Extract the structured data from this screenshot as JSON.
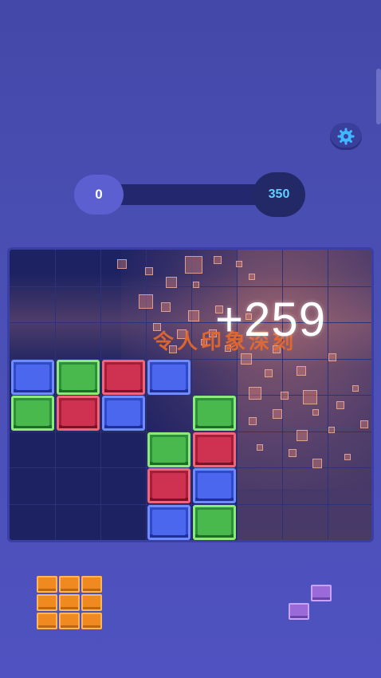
{
  "hud": {
    "current_score": "0",
    "target_score": "350",
    "progress": 0
  },
  "combo": {
    "points": "+259",
    "label": "令人印象深刻"
  },
  "colors": {
    "blue": "#4a67ee",
    "green": "#49b94d",
    "red": "#cf3250",
    "orange_piece": "#f08a20",
    "purple_piece": "#9a6ad8"
  },
  "board": {
    "columns": 8,
    "rows": 8,
    "blocks": [
      {
        "row": 3,
        "col": 0,
        "color": "blue"
      },
      {
        "row": 3,
        "col": 1,
        "color": "green"
      },
      {
        "row": 3,
        "col": 2,
        "color": "red"
      },
      {
        "row": 3,
        "col": 3,
        "color": "blue"
      },
      {
        "row": 4,
        "col": 0,
        "color": "green"
      },
      {
        "row": 4,
        "col": 1,
        "color": "red"
      },
      {
        "row": 4,
        "col": 2,
        "color": "blue"
      },
      {
        "row": 4,
        "col": 4,
        "color": "green"
      },
      {
        "row": 5,
        "col": 3,
        "color": "green"
      },
      {
        "row": 5,
        "col": 4,
        "color": "red"
      },
      {
        "row": 6,
        "col": 3,
        "color": "red"
      },
      {
        "row": 6,
        "col": 4,
        "color": "blue"
      },
      {
        "row": 7,
        "col": 3,
        "color": "blue"
      },
      {
        "row": 7,
        "col": 4,
        "color": "green"
      }
    ]
  },
  "pieces": [
    {
      "name": "orange-3x3-piece",
      "color": "orange",
      "cells": [
        [
          0,
          0
        ],
        [
          0,
          1
        ],
        [
          0,
          2
        ],
        [
          1,
          0
        ],
        [
          1,
          1
        ],
        [
          1,
          2
        ],
        [
          2,
          0
        ],
        [
          2,
          1
        ],
        [
          2,
          2
        ]
      ]
    },
    {
      "name": "purple-diagonal-piece",
      "color": "purple",
      "cells": [
        [
          0,
          1
        ],
        [
          1,
          0
        ]
      ]
    }
  ],
  "icons": {
    "settings": "gear-icon"
  }
}
